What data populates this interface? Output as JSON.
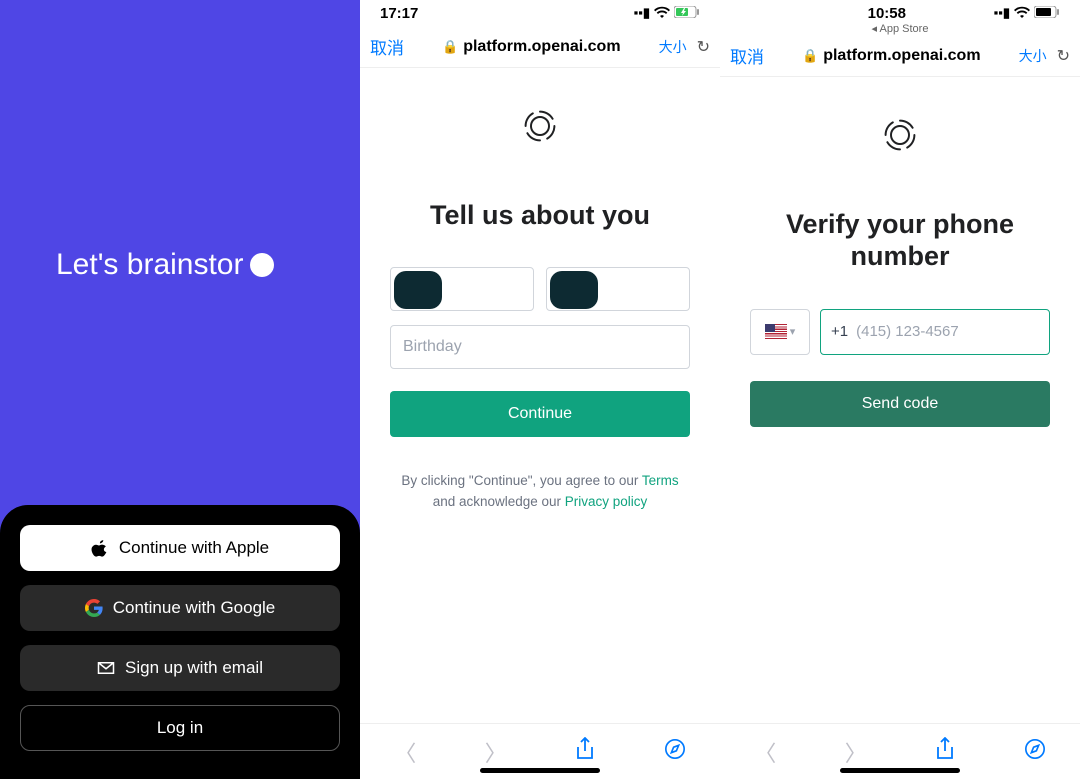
{
  "screen1": {
    "tagline": "Let's brainstor",
    "buttons": {
      "apple": "Continue with Apple",
      "google": "Continue with Google",
      "email": "Sign up with email",
      "login": "Log in"
    }
  },
  "screen2": {
    "status_time": "17:17",
    "safari": {
      "cancel": "取消",
      "url": "platform.openai.com",
      "aa": "大小"
    },
    "title": "Tell us about you",
    "birthday_placeholder": "Birthday",
    "continue_label": "Continue",
    "legal_prefix": "By clicking \"Continue\", you agree to our ",
    "legal_terms": "Terms",
    "legal_mid": " and acknowledge our ",
    "legal_privacy": "Privacy policy"
  },
  "screen3": {
    "status_time": "10:58",
    "appstore_back": "◂ App Store",
    "safari": {
      "cancel": "取消",
      "url": "platform.openai.com",
      "aa": "大小"
    },
    "title": "Verify your phone number",
    "dial_code": "+1",
    "phone_placeholder": "(415) 123-4567",
    "send_label": "Send code"
  }
}
